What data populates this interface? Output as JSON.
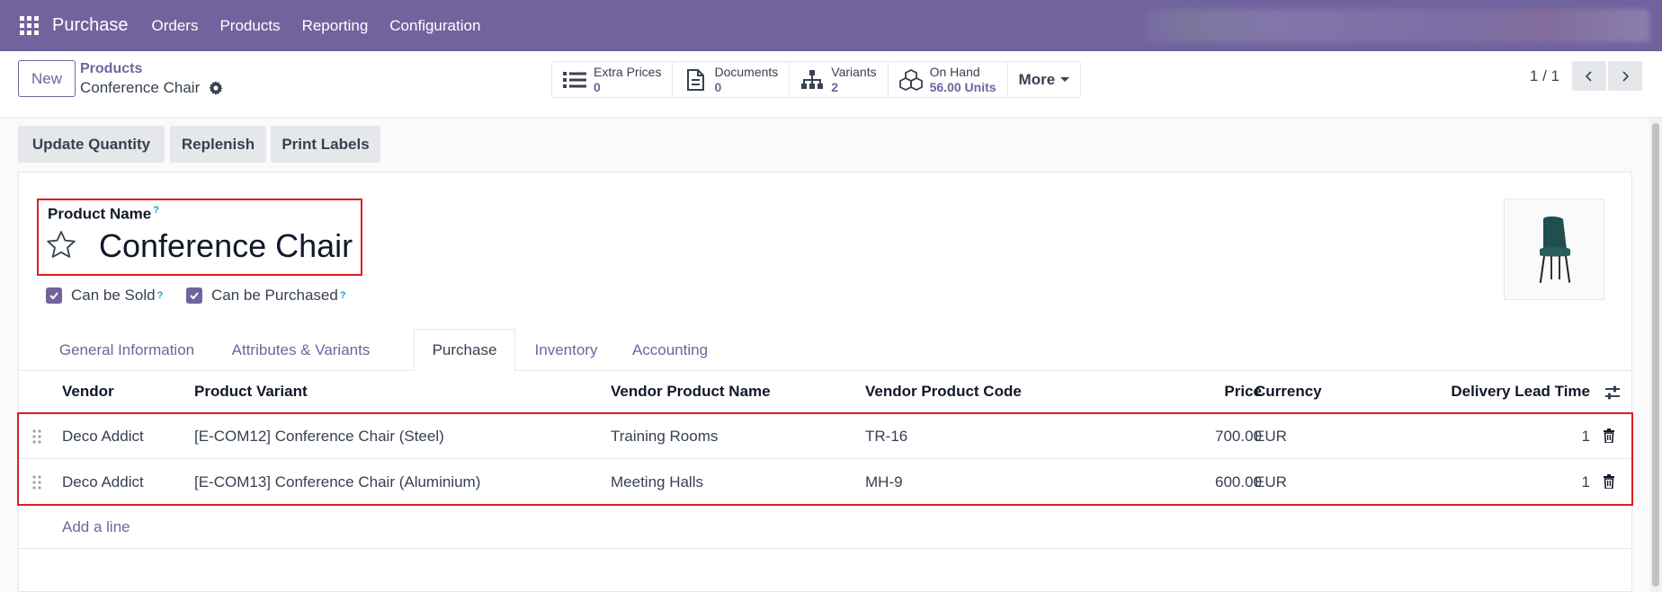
{
  "navbar": {
    "app_name": "Purchase",
    "menu": [
      "Orders",
      "Products",
      "Reporting",
      "Configuration"
    ]
  },
  "control_panel": {
    "new_label": "New",
    "breadcrumb_parent": "Products",
    "breadcrumb_current": "Conference Chair",
    "smart_buttons": [
      {
        "label": "Extra Prices",
        "value": "0",
        "icon": "list-icon"
      },
      {
        "label": "Documents",
        "value": "0",
        "icon": "document-icon"
      },
      {
        "label": "Variants",
        "value": "2",
        "icon": "sitemap-icon"
      },
      {
        "label": "On Hand",
        "value": "56.00 Units",
        "icon": "cubes-icon"
      }
    ],
    "more_label": "More",
    "pager": "1 / 1"
  },
  "actions": [
    "Update Quantity",
    "Replenish",
    "Print Labels"
  ],
  "form": {
    "product_name_label": "Product Name",
    "help_mark": "?",
    "product_name": "Conference Chair",
    "can_be_sold": "Can be Sold",
    "can_be_purchased": "Can be Purchased"
  },
  "tabs": [
    "General Information",
    "Attributes & Variants",
    "Purchase",
    "Inventory",
    "Accounting"
  ],
  "active_tab": "Purchase",
  "table": {
    "headers": [
      "Vendor",
      "Product Variant",
      "Vendor Product Name",
      "Vendor Product Code",
      "Price",
      "Currency",
      "Delivery Lead Time"
    ],
    "rows": [
      [
        "Deco Addict",
        "[E-COM12] Conference Chair (Steel)",
        "Training Rooms",
        "TR-16",
        "700.00",
        "EUR",
        "1"
      ],
      [
        "Deco Addict",
        "[E-COM13] Conference Chair (Aluminium)",
        "Meeting Halls",
        "MH-9",
        "600.00",
        "EUR",
        "1"
      ]
    ],
    "add_line": "Add a line"
  },
  "colors": {
    "brand": "#71639e",
    "highlight": "#e11d1d",
    "help": "#0ea5c6"
  }
}
